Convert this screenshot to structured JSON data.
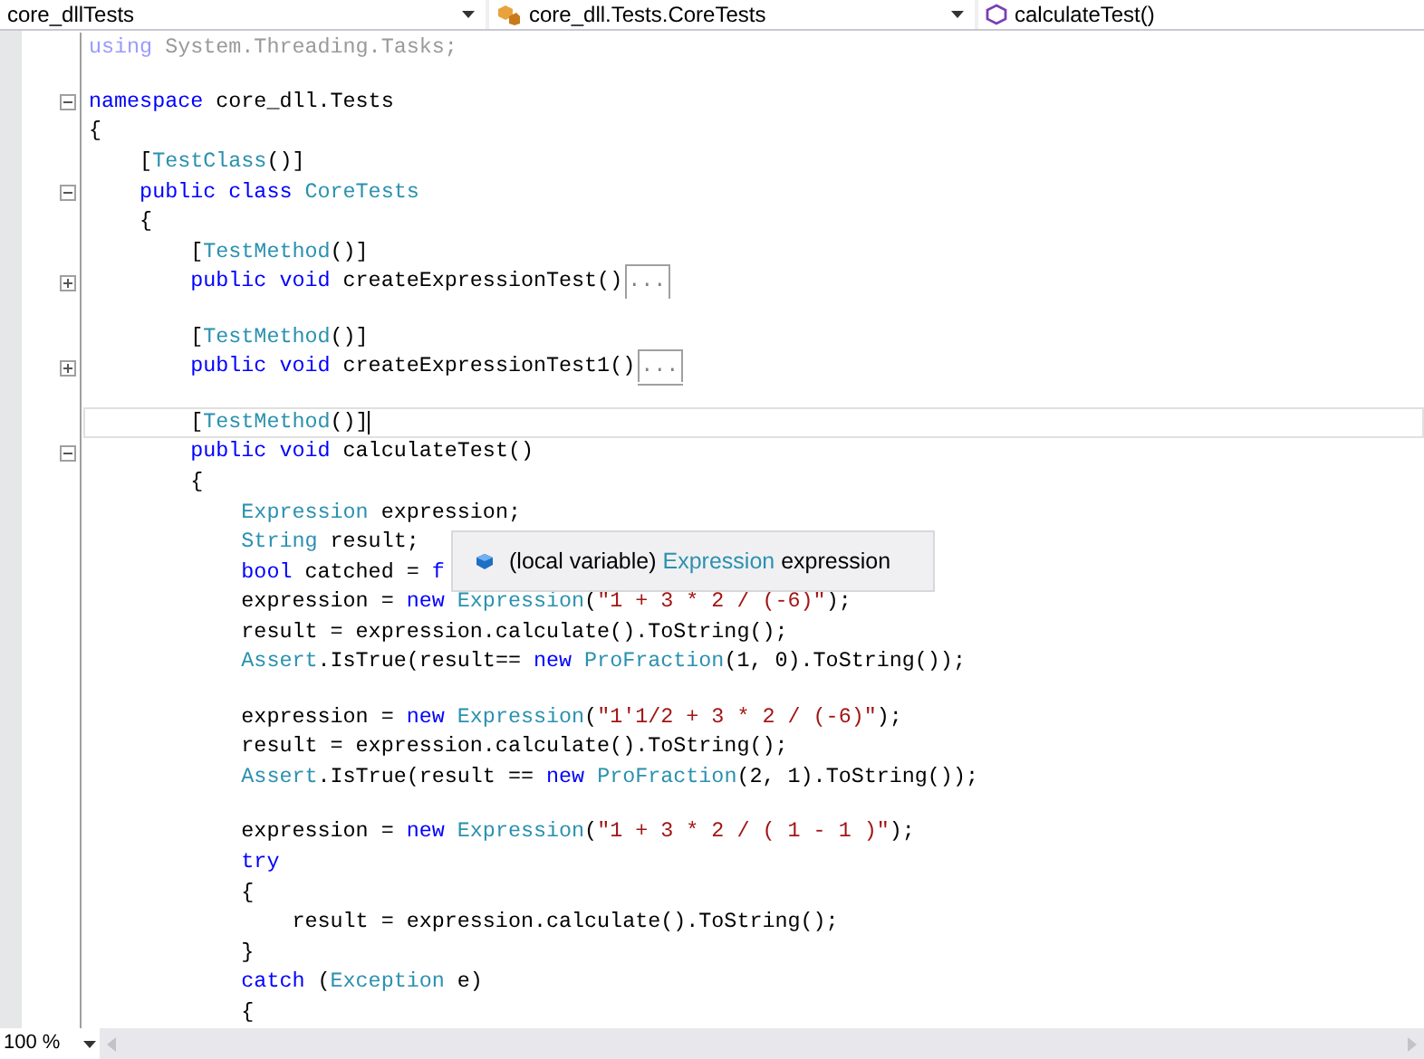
{
  "navigation_bar": [
    {
      "label": "core_dllTests"
    },
    {
      "label": "core_dll.Tests.CoreTests"
    },
    {
      "label": "calculateTest()"
    }
  ],
  "code_lines": [
    {
      "kind": "code",
      "current": false,
      "tokens": [
        {
          "kind": "faded-keyword",
          "text": "using"
        },
        {
          "kind": "faded",
          "text": " System.Threading.Tasks;"
        }
      ]
    },
    {
      "kind": "blank",
      "current": false
    },
    {
      "kind": "code",
      "current": false,
      "expanded": true,
      "tokens": [
        {
          "kind": "keyword",
          "text": "namespace"
        },
        {
          "kind": "plain",
          "text": " core_dll.Tests"
        }
      ]
    },
    {
      "kind": "code",
      "current": false,
      "tokens": [
        {
          "kind": "plain",
          "text": "{"
        }
      ]
    },
    {
      "kind": "code",
      "current": false,
      "tokens": [
        {
          "kind": "plain",
          "text": "    ["
        },
        {
          "kind": "type",
          "text": "TestClass"
        },
        {
          "kind": "plain",
          "text": "()]"
        }
      ]
    },
    {
      "kind": "code",
      "current": false,
      "expanded": true,
      "tokens": [
        {
          "kind": "keyword",
          "text": "    public class "
        },
        {
          "kind": "type",
          "text": "CoreTests"
        }
      ]
    },
    {
      "kind": "code",
      "current": false,
      "tokens": [
        {
          "kind": "plain",
          "text": "    {"
        }
      ]
    },
    {
      "kind": "code",
      "current": false,
      "tokens": [
        {
          "kind": "plain",
          "text": "        ["
        },
        {
          "kind": "type",
          "text": "TestMethod"
        },
        {
          "kind": "plain",
          "text": "()]"
        }
      ]
    },
    {
      "kind": "code",
      "current": false,
      "expanded": false,
      "tokens": [
        {
          "kind": "keyword",
          "text": "        public void"
        },
        {
          "kind": "plain",
          "text": " createExpressionTest()"
        },
        {
          "kind": "collapsed",
          "text": "..."
        }
      ]
    },
    {
      "kind": "blank",
      "current": false
    },
    {
      "kind": "code",
      "current": false,
      "tokens": [
        {
          "kind": "plain",
          "text": "        ["
        },
        {
          "kind": "type",
          "text": "TestMethod"
        },
        {
          "kind": "plain",
          "text": "()]"
        }
      ]
    },
    {
      "kind": "code",
      "current": false,
      "expanded": false,
      "tokens": [
        {
          "kind": "keyword",
          "text": "        public void"
        },
        {
          "kind": "plain",
          "text": " createExpressionTest1()"
        },
        {
          "kind": "collapsed",
          "text": "..."
        }
      ]
    },
    {
      "kind": "blank",
      "current": false
    },
    {
      "kind": "code",
      "current": true,
      "tokens": [
        {
          "kind": "plain",
          "text": "        ["
        },
        {
          "kind": "type",
          "text": "TestMethod"
        },
        {
          "kind": "plain",
          "text": "()]"
        }
      ]
    },
    {
      "kind": "code",
      "current": false,
      "expanded": true,
      "tokens": [
        {
          "kind": "keyword",
          "text": "        public void"
        },
        {
          "kind": "plain",
          "text": " calculateTest()"
        }
      ]
    },
    {
      "kind": "code",
      "current": false,
      "tokens": [
        {
          "kind": "plain",
          "text": "        {"
        }
      ]
    },
    {
      "kind": "code",
      "current": false,
      "tokens": [
        {
          "kind": "type",
          "text": "            Expression"
        },
        {
          "kind": "plain",
          "text": " expression;"
        }
      ]
    },
    {
      "kind": "code",
      "current": false,
      "tokens": [
        {
          "kind": "type",
          "text": "            String"
        },
        {
          "kind": "plain",
          "text": " result;"
        }
      ]
    },
    {
      "kind": "code",
      "current": false,
      "tokens": [
        {
          "kind": "keyword",
          "text": "            bool"
        },
        {
          "kind": "plain",
          "text": " catched = "
        },
        {
          "kind": "keyword",
          "text": "f"
        }
      ]
    },
    {
      "kind": "code",
      "current": false,
      "tokens": [
        {
          "kind": "plain",
          "text": "            expression = "
        },
        {
          "kind": "keyword",
          "text": "new "
        },
        {
          "kind": "type",
          "text": "Expression"
        },
        {
          "kind": "plain",
          "text": "("
        },
        {
          "kind": "string",
          "text": "\"1 + 3 * 2 / (-6)\""
        },
        {
          "kind": "plain",
          "text": ");"
        }
      ]
    },
    {
      "kind": "code",
      "current": false,
      "tokens": [
        {
          "kind": "plain",
          "text": "            result = expression.calculate().ToString();"
        }
      ]
    },
    {
      "kind": "code",
      "current": false,
      "tokens": [
        {
          "kind": "type",
          "text": "            Assert"
        },
        {
          "kind": "plain",
          "text": ".IsTrue(result== "
        },
        {
          "kind": "keyword",
          "text": "new "
        },
        {
          "kind": "type",
          "text": "ProFraction"
        },
        {
          "kind": "plain",
          "text": "(1, 0).ToString());"
        }
      ]
    },
    {
      "kind": "blank",
      "current": false
    },
    {
      "kind": "code",
      "current": false,
      "tokens": [
        {
          "kind": "plain",
          "text": "            expression = "
        },
        {
          "kind": "keyword",
          "text": "new "
        },
        {
          "kind": "type",
          "text": "Expression"
        },
        {
          "kind": "plain",
          "text": "("
        },
        {
          "kind": "string",
          "text": "\"1'1/2 + 3 * 2 / (-6)\""
        },
        {
          "kind": "plain",
          "text": ");"
        }
      ]
    },
    {
      "kind": "code",
      "current": false,
      "tokens": [
        {
          "kind": "plain",
          "text": "            result = expression.calculate().ToString();"
        }
      ]
    },
    {
      "kind": "code",
      "current": false,
      "tokens": [
        {
          "kind": "type",
          "text": "            Assert"
        },
        {
          "kind": "plain",
          "text": ".IsTrue(result == "
        },
        {
          "kind": "keyword",
          "text": "new "
        },
        {
          "kind": "type",
          "text": "ProFraction"
        },
        {
          "kind": "plain",
          "text": "(2, 1).ToString());"
        }
      ]
    },
    {
      "kind": "blank",
      "current": false
    },
    {
      "kind": "code",
      "current": false,
      "tokens": [
        {
          "kind": "plain",
          "text": "            expression = "
        },
        {
          "kind": "keyword",
          "text": "new "
        },
        {
          "kind": "type",
          "text": "Expression"
        },
        {
          "kind": "plain",
          "text": "("
        },
        {
          "kind": "string",
          "text": "\"1 + 3 * 2 / ( 1 - 1 )\""
        },
        {
          "kind": "plain",
          "text": ");"
        }
      ]
    },
    {
      "kind": "code",
      "current": false,
      "tokens": [
        {
          "kind": "keyword",
          "text": "            try"
        }
      ]
    },
    {
      "kind": "code",
      "current": false,
      "tokens": [
        {
          "kind": "plain",
          "text": "            {"
        }
      ]
    },
    {
      "kind": "code",
      "current": false,
      "tokens": [
        {
          "kind": "plain",
          "text": "                result = expression.calculate().ToString();"
        }
      ]
    },
    {
      "kind": "code",
      "current": false,
      "tokens": [
        {
          "kind": "plain",
          "text": "            }"
        }
      ]
    },
    {
      "kind": "code",
      "current": false,
      "tokens": [
        {
          "kind": "keyword",
          "text": "            catch"
        },
        {
          "kind": "plain",
          "text": " ("
        },
        {
          "kind": "type",
          "text": "Exception"
        },
        {
          "kind": "plain",
          "text": " e)"
        }
      ]
    },
    {
      "kind": "code",
      "current": false,
      "tokens": [
        {
          "kind": "plain",
          "text": "            {"
        }
      ]
    }
  ],
  "tooltip": {
    "tokens": [
      {
        "kind": "plain",
        "text": "(local variable) "
      },
      {
        "kind": "type",
        "text": "Expression"
      },
      {
        "kind": "plain",
        "text": " expression"
      }
    ]
  },
  "status_bar": {
    "zoom": "100 %"
  }
}
